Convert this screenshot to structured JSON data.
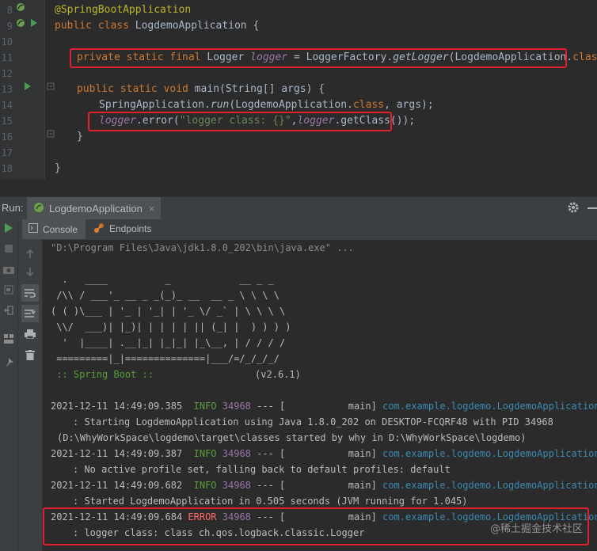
{
  "editor": {
    "lines": [
      {
        "no": "8",
        "text": "@SpringBootApplication"
      },
      {
        "no": "9",
        "text": "public class LogdemoApplication {"
      },
      {
        "no": "10",
        "text": ""
      },
      {
        "no": "11",
        "text": "private static final Logger logger = LoggerFactory.getLogger(LogdemoApplication.class);"
      },
      {
        "no": "12",
        "text": ""
      },
      {
        "no": "13",
        "text": "public static void main(String[] args) {"
      },
      {
        "no": "14",
        "text": "SpringApplication.run(LogdemoApplication.class, args);"
      },
      {
        "no": "15",
        "text": "logger.error(\"logger class: {}\",logger.getClass());"
      },
      {
        "no": "16",
        "text": "}"
      },
      {
        "no": "17",
        "text": ""
      },
      {
        "no": "18",
        "text": "}"
      }
    ]
  },
  "run": {
    "label": "Run:",
    "tab": "LogdemoApplication",
    "close": "×",
    "subtabs": {
      "console": "Console",
      "endpoints": "Endpoints"
    }
  },
  "console": {
    "command": "\"D:\\Program Files\\Java\\jdk1.8.0_202\\bin\\java.exe\" ...",
    "banner": [
      "  .   ____          _            __ _ _",
      " /\\\\ / ___'_ __ _ _(_)_ __  __ _ \\ \\ \\ \\",
      "( ( )\\___ | '_ | '_| | '_ \\/ _` | \\ \\ \\ \\",
      " \\\\/  ___)| |_)| | | | | || (_| |  ) ) ) )",
      "  '  |____| .__|_| |_|_| |_\\__, | / / / /",
      " =========|_|==============|___/=/_/_/_/"
    ],
    "spring_label": " :: Spring Boot ::",
    "spring_version": "(v2.6.1)",
    "logs": [
      {
        "ts": "2021-12-11 14:49:09.385",
        "level": "INFO",
        "pid": "34968",
        "sep": "--- [",
        "thread": "main]",
        "logger": "com.example.logdemo.LogdemoApplication",
        "msg": ": Starting LogdemoApplication using Java 1.8.0_202 on DESKTOP-FCQRF48 with PID 34968",
        "msg2": "(D:\\WhyWorkSpace\\logdemo\\target\\classes started by why in D:\\WhyWorkSpace\\logdemo)"
      },
      {
        "ts": "2021-12-11 14:49:09.387",
        "level": "INFO",
        "pid": "34968",
        "sep": "--- [",
        "thread": "main]",
        "logger": "com.example.logdemo.LogdemoApplication",
        "msg": ": No active profile set, falling back to default profiles: default"
      },
      {
        "ts": "2021-12-11 14:49:09.682",
        "level": "INFO",
        "pid": "34968",
        "sep": "--- [",
        "thread": "main]",
        "logger": "com.example.logdemo.LogdemoApplication",
        "msg": ": Started LogdemoApplication in 0.505 seconds (JVM running for 1.045)"
      },
      {
        "ts": "2021-12-11 14:49:09.684",
        "level": "ERROR",
        "pid": "34968",
        "sep": "--- [",
        "thread": "main]",
        "logger": "com.example.logdemo.LogdemoApplication",
        "msg": ": logger class: class ch.qos.logback.classic.Logger"
      }
    ]
  },
  "watermark": "@稀土掘金技术社区",
  "colors": {
    "highlight_box": "#e0202c",
    "info": "#5a9d3c",
    "error": "#ff6b68",
    "logger": "#3b8ab3"
  }
}
